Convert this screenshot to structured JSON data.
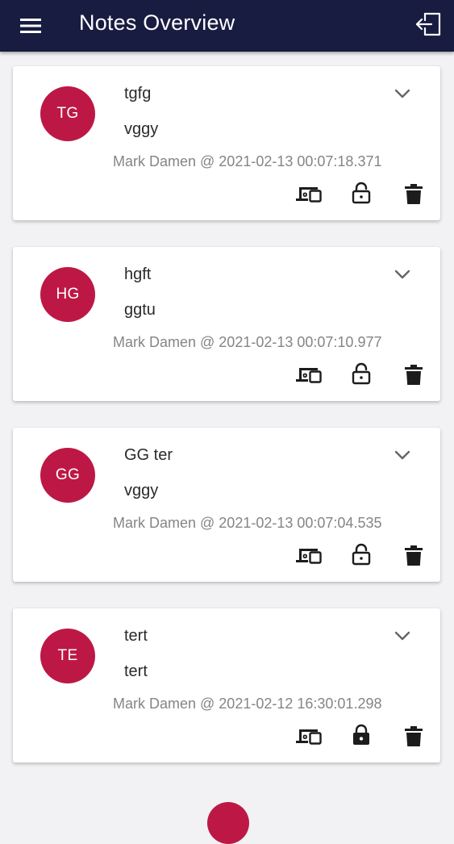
{
  "app_bar": {
    "title": "Notes Overview",
    "menu_icon": "hamburger-menu-icon",
    "logout_icon": "logout-icon",
    "background": "#181c41"
  },
  "theme": {
    "accent": "#bd1845",
    "page_background": "#f2f2f4"
  },
  "notes": [
    {
      "initials": "TG",
      "title": "tgfg",
      "body": "vggy",
      "meta": "Mark Damen @ 2021-02-13 00:07:18.371",
      "locked": false
    },
    {
      "initials": "HG",
      "title": "hgft",
      "body": "ggtu",
      "meta": "Mark Damen @ 2021-02-13 00:07:10.977",
      "locked": false
    },
    {
      "initials": "GG",
      "title": "GG ter",
      "body": "vggy",
      "meta": "Mark Damen @ 2021-02-13 00:07:04.535",
      "locked": false
    },
    {
      "initials": "TE",
      "title": "tert",
      "body": "tert",
      "meta": "Mark Damen @ 2021-02-12 16:30:01.298",
      "locked": true
    }
  ],
  "card_actions": {
    "devices_icon": "devices-icon",
    "lock_icon": "lock-icon",
    "delete_icon": "trash-icon",
    "expand_icon": "chevron-down-icon"
  }
}
